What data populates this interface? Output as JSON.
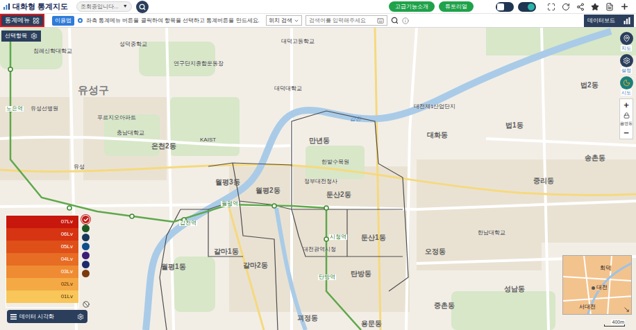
{
  "header": {
    "title": "대화형 통계지도",
    "status_dropdown": {
      "value": "조회중입니다...",
      "arrow": "▼"
    },
    "buttons": [
      "고급기능소개",
      "튜토리얼"
    ],
    "toggles": [
      {
        "on": false
      },
      {
        "on": true
      }
    ]
  },
  "toolbar": {
    "menu_button": "통계메뉴",
    "help_button": "이용법",
    "hint": "좌측 통계메뉴 버튼을 클릭하여 항목을 선택하고 통계버튼을 만드세요.",
    "location_select": "위치 검색",
    "search": {
      "placeholder": "검색어를 입력해주세요"
    },
    "databoard_button": "데이터보드"
  },
  "selection_button": "선택항목",
  "map_controls": [
    {
      "label": "지도"
    },
    {
      "label": "설정"
    },
    {
      "label": "시도"
    }
  ],
  "zoom": {
    "plus": "+",
    "lock_label": "읍면동",
    "minus": "−"
  },
  "legend": {
    "levels": [
      {
        "label": "07Lv",
        "color": "#c8170d"
      },
      {
        "label": "06Lv",
        "color": "#d63412"
      },
      {
        "label": "05Lv",
        "color": "#df5019"
      },
      {
        "label": "04Lv",
        "color": "#e76c24"
      },
      {
        "label": "03Lv",
        "color": "#ef8b33"
      },
      {
        "label": "02Lv",
        "color": "#f4a945"
      },
      {
        "label": "01Lv",
        "color": "#f8c659"
      }
    ],
    "palettes": [
      {
        "color": "#c0201b",
        "selected": true
      },
      {
        "color": "#1c5a24",
        "selected": false
      },
      {
        "color": "#16385c",
        "selected": false
      },
      {
        "color": "#0f4f8c",
        "selected": false
      },
      {
        "color": "#3b1d74",
        "selected": false
      },
      {
        "color": "#1c2a6b",
        "selected": false
      },
      {
        "color": "#7a3a0e",
        "selected": false
      }
    ],
    "footer": "데이터 시각화"
  },
  "map_labels": [
    {
      "text": "침례신학대학교",
      "kind": "poi"
    },
    {
      "text": "성덕중학교",
      "kind": "poi"
    },
    {
      "text": "연구단지종합운동장",
      "kind": "poi"
    },
    {
      "text": "대덕고등학교",
      "kind": "poi"
    },
    {
      "text": "대덕대학교",
      "kind": "poi"
    },
    {
      "text": "유성구",
      "kind": "area"
    },
    {
      "text": "노은역",
      "kind": "station"
    },
    {
      "text": "유성선병원",
      "kind": "poi"
    },
    {
      "text": "푸르지오아파트",
      "kind": "poi"
    },
    {
      "text": "충남대학교",
      "kind": "poi"
    },
    {
      "text": "KAIST",
      "kind": "poi"
    },
    {
      "text": "온천2동",
      "kind": "district"
    },
    {
      "text": "갑천",
      "kind": "water"
    },
    {
      "text": "만년동",
      "kind": "district"
    },
    {
      "text": "한밭수목원",
      "kind": "poi"
    },
    {
      "text": "정부대전청사",
      "kind": "poi"
    },
    {
      "text": "둔산2동",
      "kind": "district"
    },
    {
      "text": "월평3동",
      "kind": "district"
    },
    {
      "text": "월평2동",
      "kind": "district"
    },
    {
      "text": "월평역",
      "kind": "station"
    },
    {
      "text": "갑천역",
      "kind": "station"
    },
    {
      "text": "유성",
      "kind": "poi"
    },
    {
      "text": "갈마1동",
      "kind": "district"
    },
    {
      "text": "갈마2동",
      "kind": "district"
    },
    {
      "text": "월평1동",
      "kind": "district"
    },
    {
      "text": "대전광역시청",
      "kind": "poi"
    },
    {
      "text": "시청역",
      "kind": "station"
    },
    {
      "text": "둔산1동",
      "kind": "district"
    },
    {
      "text": "탄방역",
      "kind": "station"
    },
    {
      "text": "탄방동",
      "kind": "district"
    },
    {
      "text": "대전제1산업단지",
      "kind": "poi"
    },
    {
      "text": "대화동",
      "kind": "district"
    },
    {
      "text": "법1동",
      "kind": "district"
    },
    {
      "text": "법2동",
      "kind": "district"
    },
    {
      "text": "송촌동",
      "kind": "district"
    },
    {
      "text": "중리동",
      "kind": "district"
    },
    {
      "text": "한남대학교",
      "kind": "poi"
    },
    {
      "text": "오정동",
      "kind": "district"
    },
    {
      "text": "성남동",
      "kind": "district"
    },
    {
      "text": "중촌동",
      "kind": "district"
    },
    {
      "text": "괴정동",
      "kind": "district"
    },
    {
      "text": "용문동",
      "kind": "district"
    }
  ],
  "minimap": {
    "labels": [
      "회덕",
      "대전",
      "서대전"
    ]
  },
  "scale": "400m"
}
